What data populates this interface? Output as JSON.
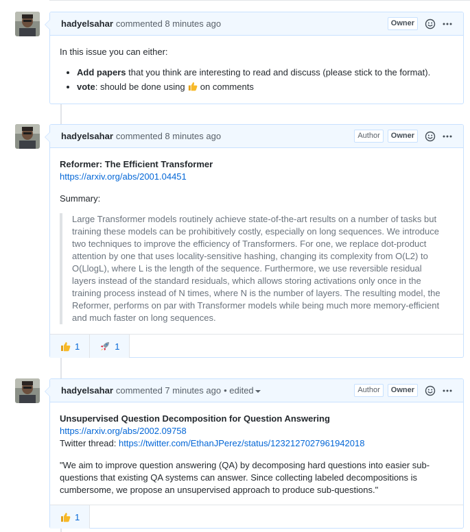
{
  "comments": [
    {
      "author": "hadyelsahar",
      "meta": "commented 8 minutes ago",
      "labels": {
        "owner": "Owner"
      },
      "intro": "In this issue you can either:",
      "items": [
        {
          "bold": "Add papers",
          "rest": " that you think are interesting to read and discuss (please stick to the format)."
        },
        {
          "bold": "vote",
          "rest_before": ": should be done using ",
          "rest_after": " on comments",
          "emoji": "thumbs-up-icon"
        }
      ]
    },
    {
      "author": "hadyelsahar",
      "meta": "commented 8 minutes ago",
      "labels": {
        "author": "Author",
        "owner": "Owner"
      },
      "title": "Reformer: The Efficient Transformer",
      "link": "https://arxiv.org/abs/2001.04451",
      "summary_label": "Summary:",
      "quote": "Large Transformer models routinely achieve state-of-the-art results on a number of tasks but training these models can be prohibitively costly, especially on long sequences. We introduce two techniques to improve the efficiency of Transformers. For one, we replace dot-product attention by one that uses locality-sensitive hashing, changing its complexity from O(L2) to O(LlogL), where L is the length of the sequence. Furthermore, we use reversible residual layers instead of the standard residuals, which allows storing activations only once in the training process instead of N times, where N is the number of layers. The resulting model, the Reformer, performs on par with Transformer models while being much more memory-efficient and much faster on long sequences.",
      "reactions": [
        {
          "icon": "thumbs-up-icon",
          "count": "1"
        },
        {
          "icon": "rocket-icon",
          "count": "1"
        }
      ]
    },
    {
      "author": "hadyelsahar",
      "meta": "commented 7 minutes ago",
      "edited": "• edited",
      "labels": {
        "author": "Author",
        "owner": "Owner"
      },
      "title": "Unsupervised Question Decomposition for Question Answering",
      "link": "https://arxiv.org/abs/2002.09758",
      "twitter_label": "Twitter thread: ",
      "twitter_link": "https://twitter.com/EthanJPerez/status/1232127027961942018",
      "quote": "\"We aim to improve question answering (QA) by decomposing hard questions into easier sub-questions that existing QA systems can answer. Since collecting labeled decompositions is cumbersome, we propose an unsupervised approach to produce sub-questions.\"",
      "reactions": [
        {
          "icon": "thumbs-up-icon",
          "count": "1"
        }
      ]
    }
  ],
  "colors": {
    "header_bg": "#f1f8ff",
    "border": "#c8e1ff",
    "link": "#0366d6"
  }
}
